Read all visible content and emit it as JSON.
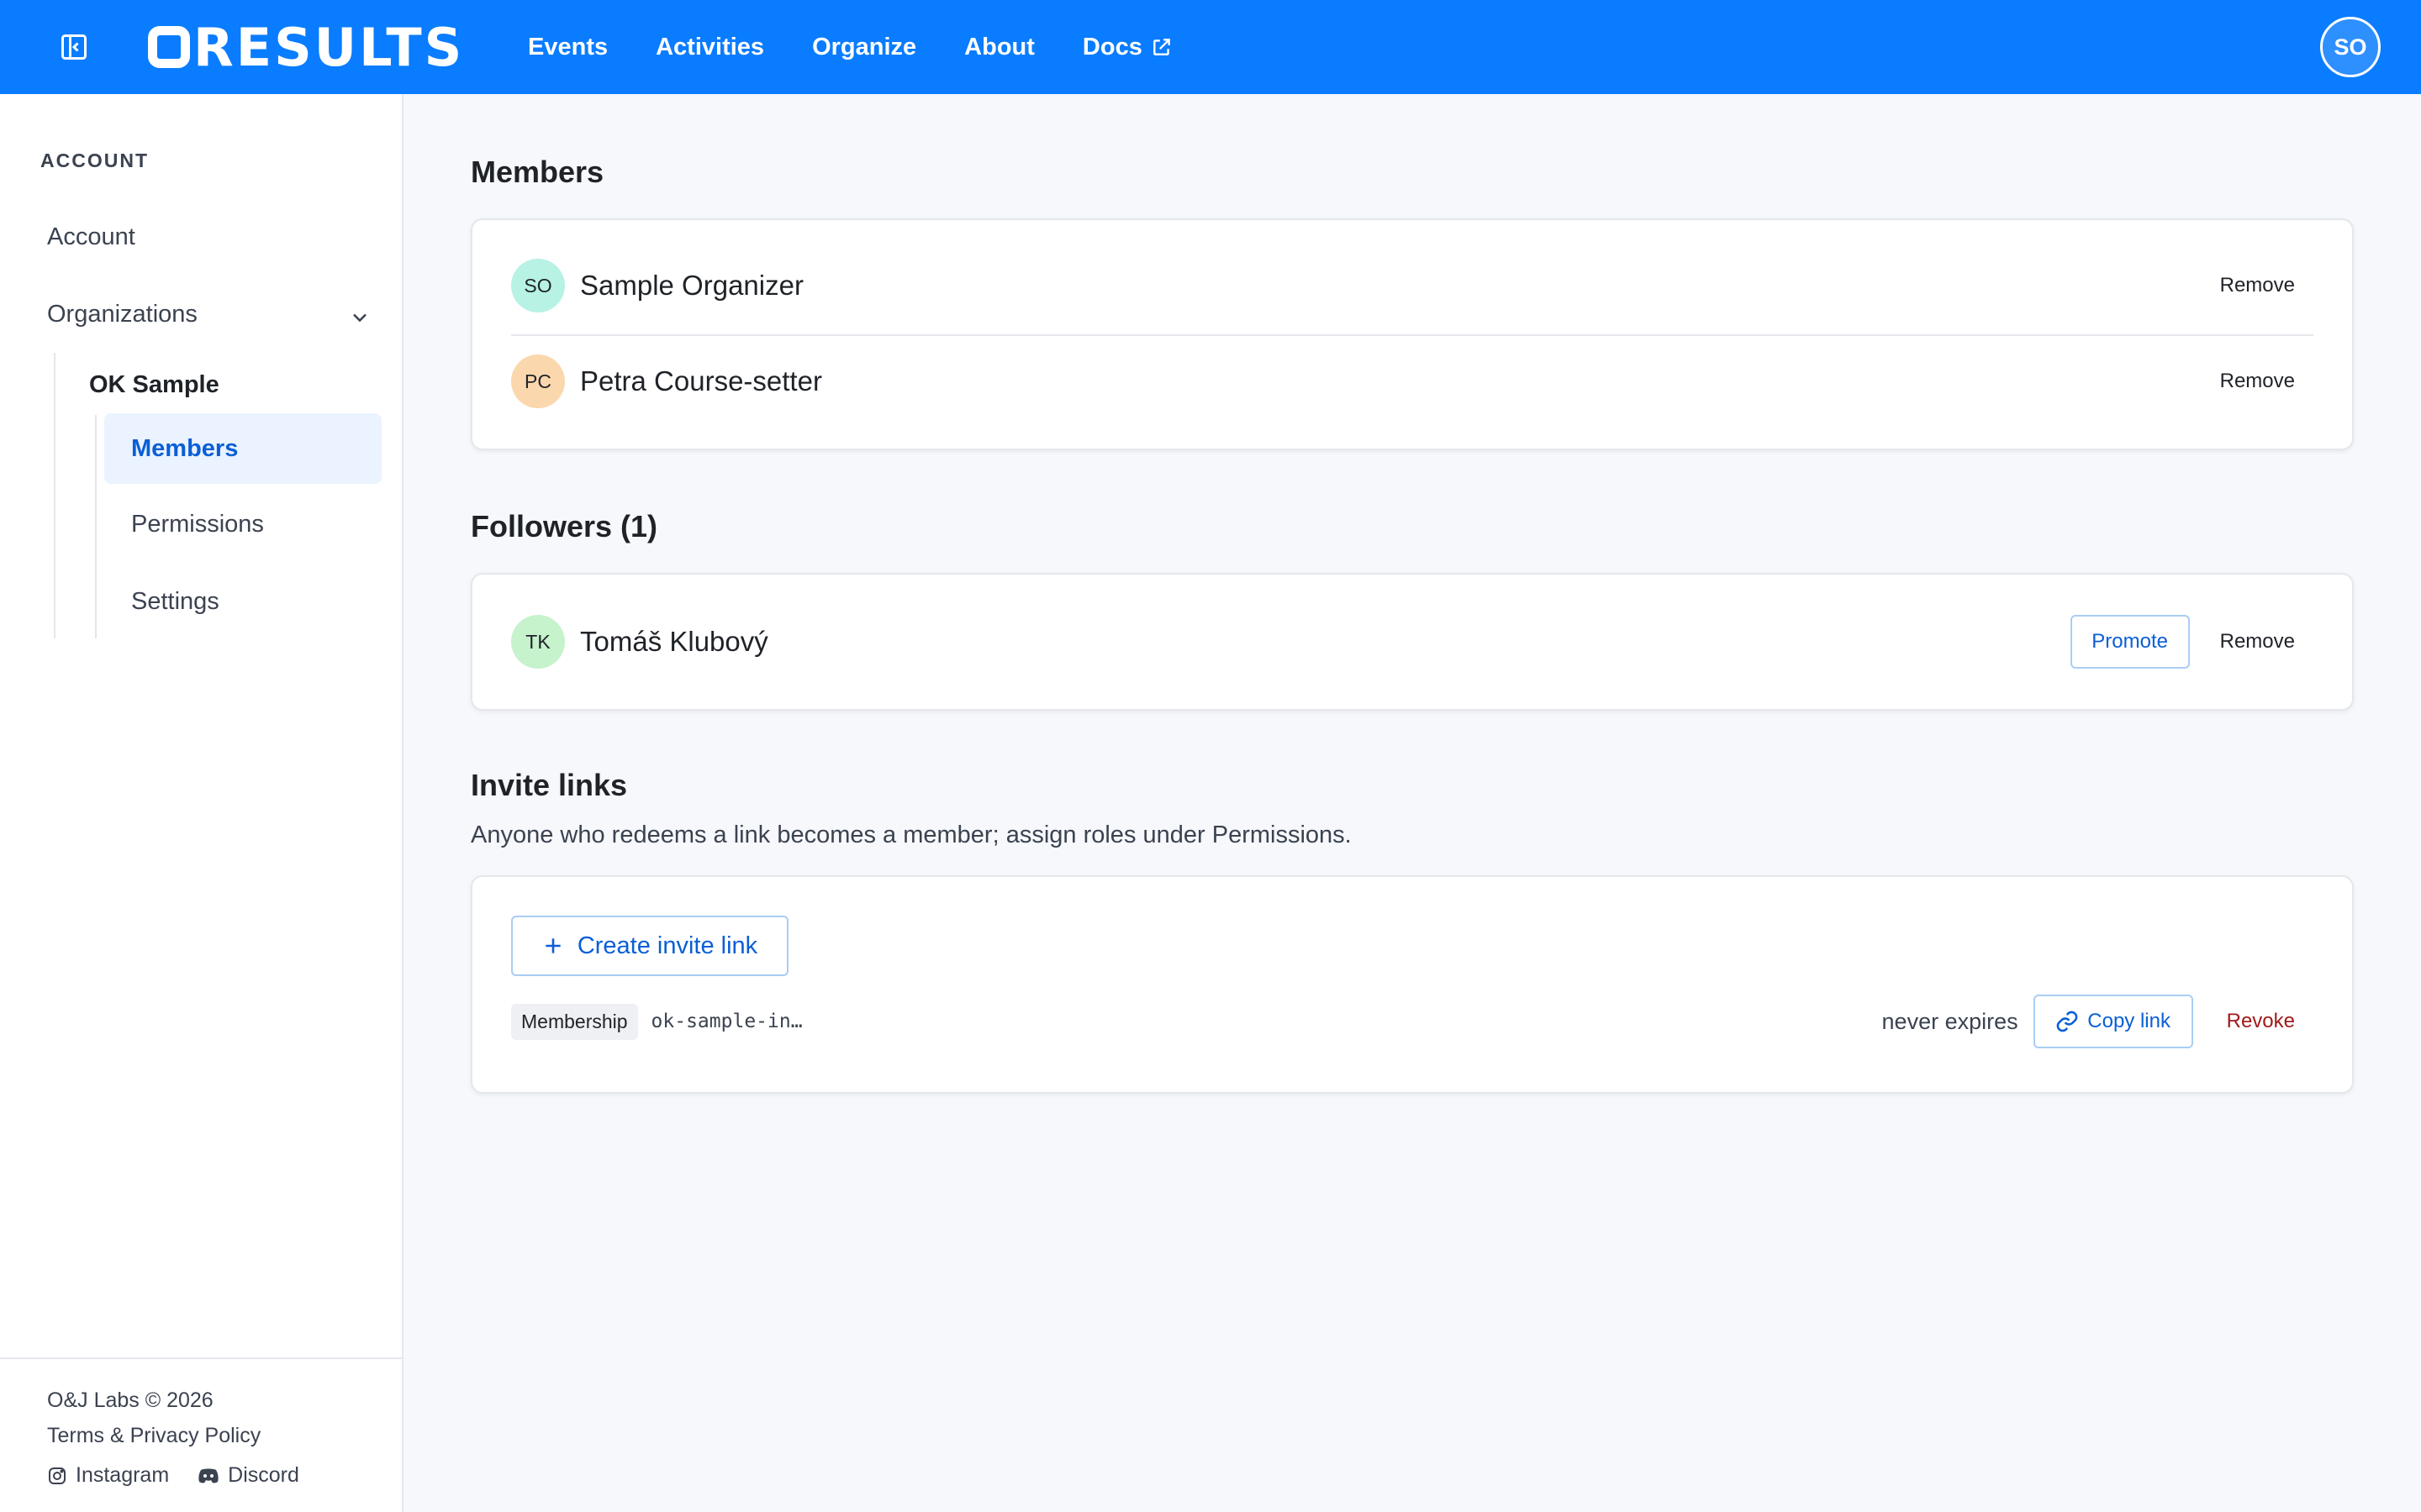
{
  "header": {
    "logo": "RESULTS",
    "nav": [
      "Events",
      "Activities",
      "Organize",
      "About",
      "Docs"
    ],
    "user_initials": "SO"
  },
  "sidebar": {
    "heading": "ACCOUNT",
    "account": "Account",
    "organizations": "Organizations",
    "org_name": "OK Sample",
    "sub_items": [
      "Members",
      "Permissions",
      "Settings"
    ],
    "footer": {
      "copyright": "O&J Labs © 2026",
      "terms": "Terms & Privacy Policy",
      "instagram": "Instagram",
      "discord": "Discord"
    }
  },
  "members": {
    "title": "Members",
    "rows": [
      {
        "initials": "SO",
        "name": "Sample Organizer",
        "action": "Remove",
        "avatar_color": "#b7f2e4"
      },
      {
        "initials": "PC",
        "name": "Petra Course-setter",
        "action": "Remove",
        "avatar_color": "#fbd7ad"
      }
    ]
  },
  "followers": {
    "title": "Followers (1)",
    "rows": [
      {
        "initials": "TK",
        "name": "Tomáš Klubový",
        "promote": "Promote",
        "action": "Remove",
        "avatar_color": "#c6f2cc"
      }
    ]
  },
  "invites": {
    "title": "Invite links",
    "subtitle": "Anyone who redeems a link becomes a member; assign roles under Permissions.",
    "create_label": "Create invite link",
    "link": {
      "role": "Membership",
      "code": "ok-sample-in…",
      "expiry": "never expires",
      "copy_label": "Copy link",
      "revoke_label": "Revoke"
    }
  },
  "colors": {
    "brand": "#0a7cff",
    "accent": "#0a5fd6",
    "danger": "#a11a1a"
  }
}
